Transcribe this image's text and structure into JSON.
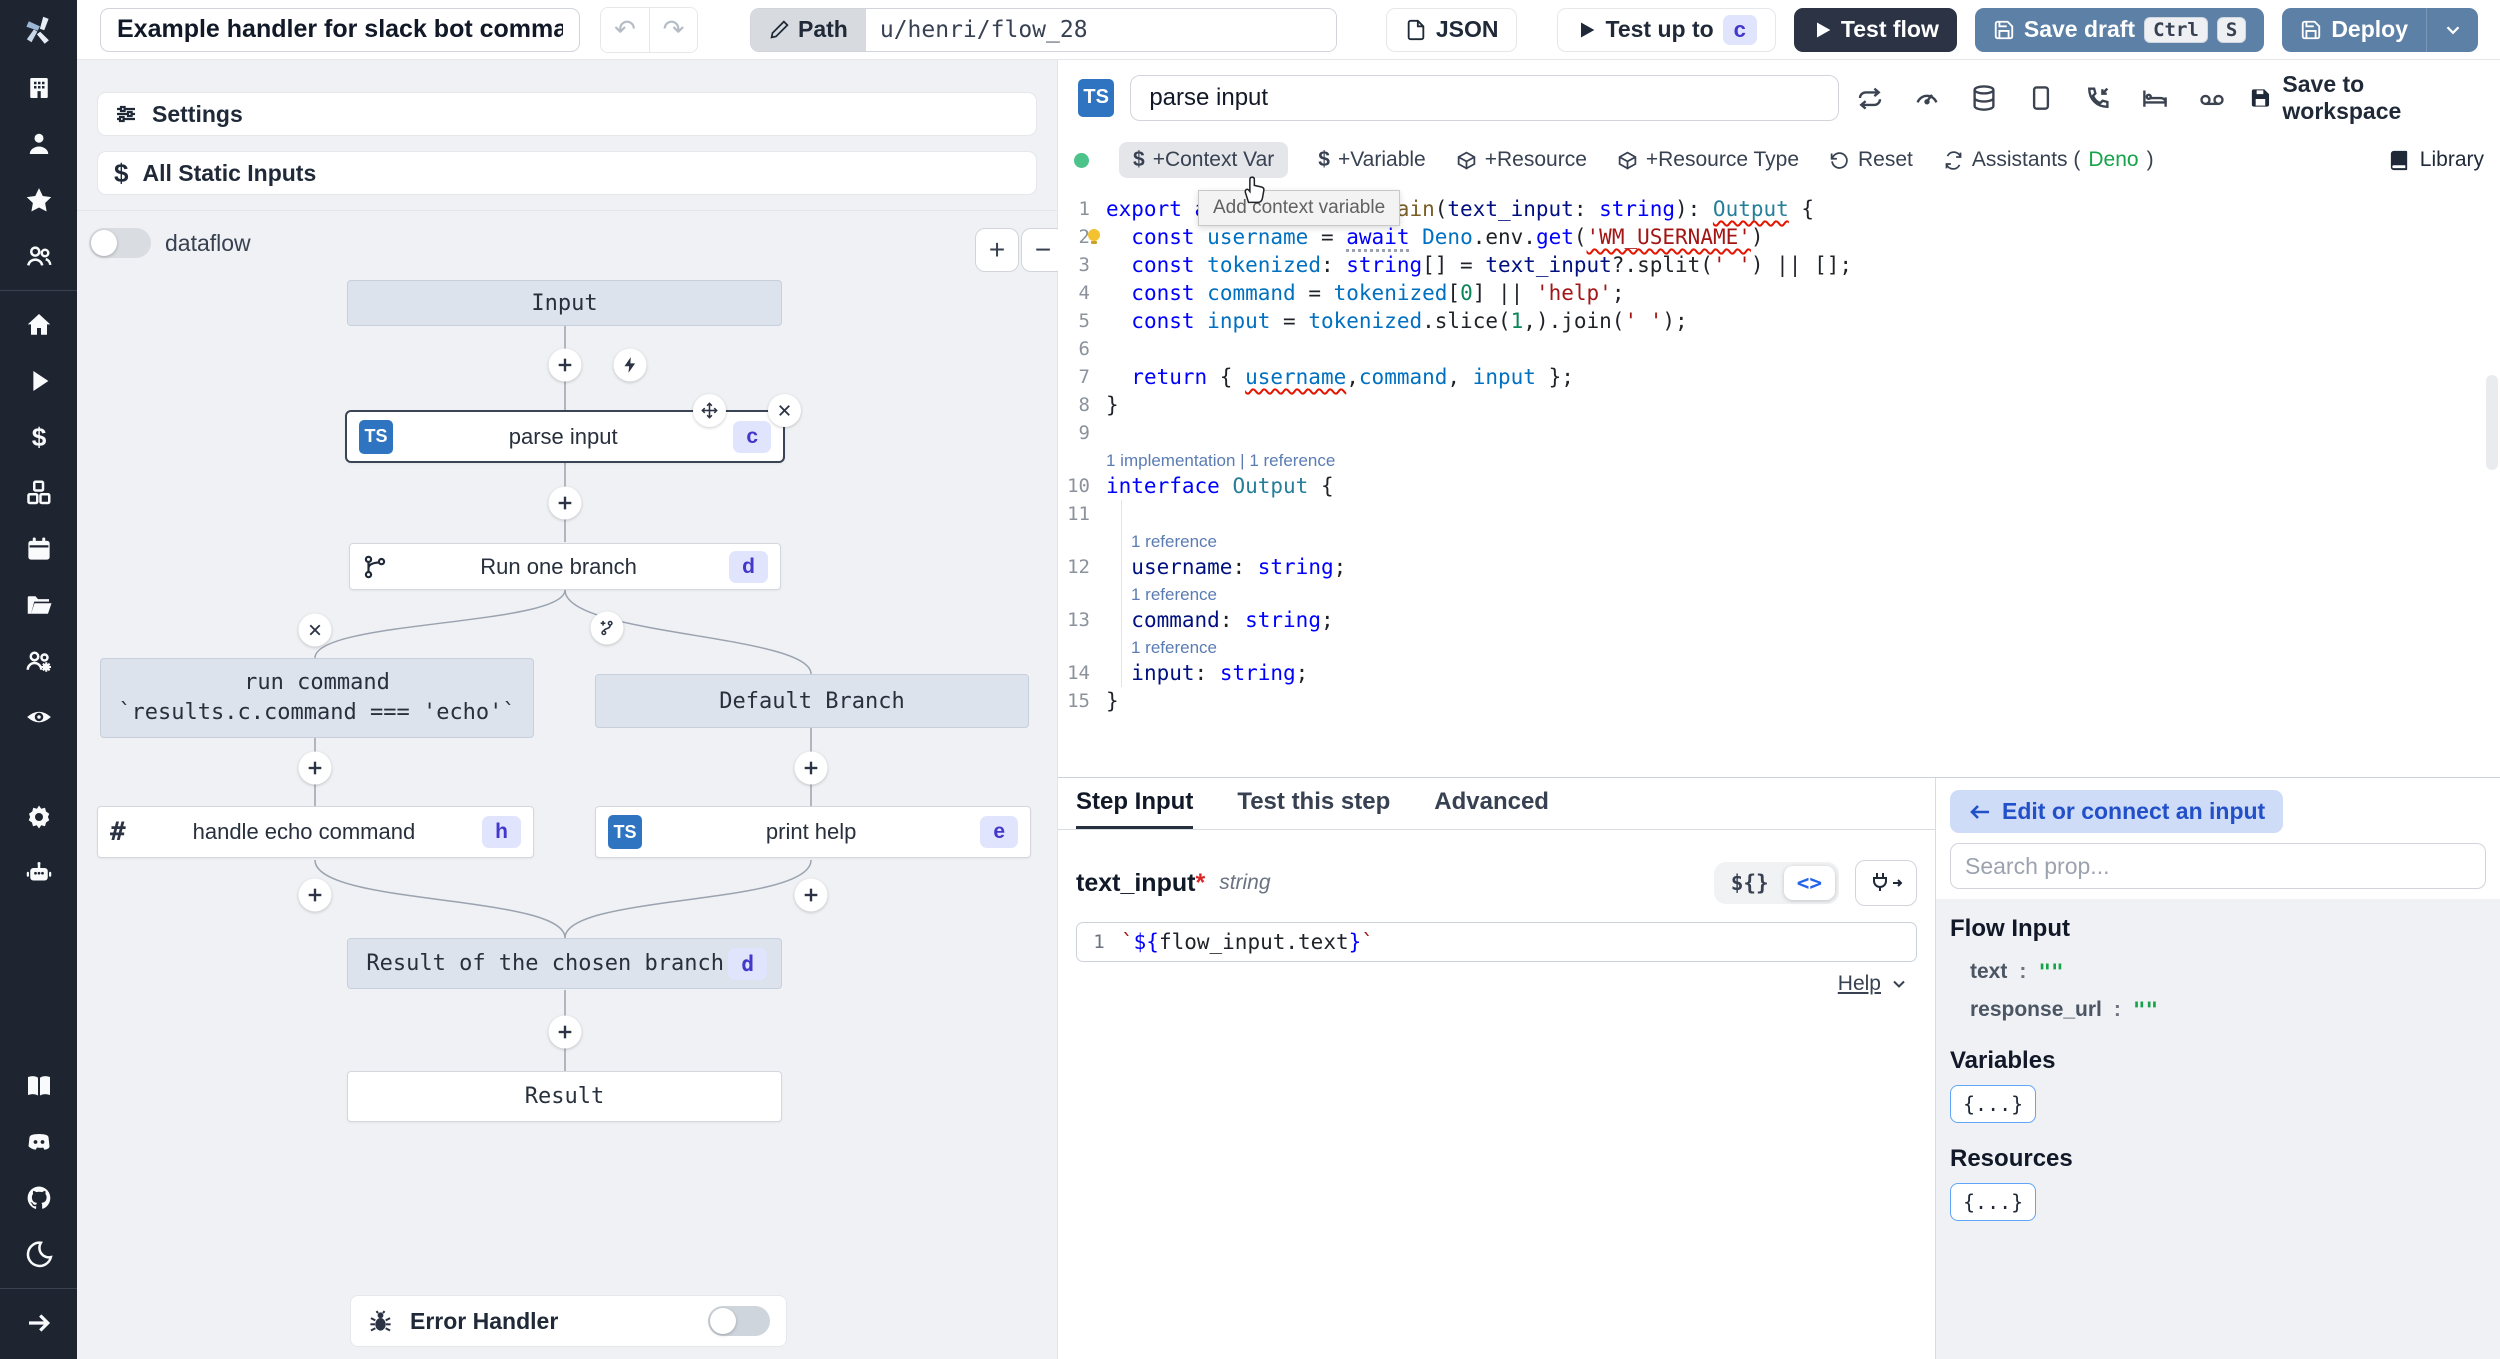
{
  "topbar": {
    "title": "Example handler for slack bot commands",
    "path": {
      "label": "Path",
      "value": "u/henri/flow_28"
    },
    "json_label": "JSON",
    "test_up_to": {
      "label": "Test up to",
      "step": "c"
    },
    "test_flow": "Test flow",
    "save_draft": {
      "label": "Save draft",
      "kbd1": "Ctrl",
      "kbd2": "S"
    },
    "deploy": "Deploy"
  },
  "sidebar": {
    "top_icons": [
      "workspace",
      "user",
      "star",
      "users"
    ],
    "menu_icons": [
      "home",
      "runs",
      "variables",
      "resources",
      "schedules",
      "folders",
      "groups",
      "audit",
      "settings",
      "ai"
    ],
    "help_icons": [
      "book",
      "discord",
      "github",
      "moon"
    ],
    "footer_icons": [
      "collapse"
    ]
  },
  "flow": {
    "settings": "Settings",
    "all_static_inputs": "All Static Inputs",
    "dataflow": "dataflow",
    "zoom_in": "+",
    "zoom_out": "−",
    "error_handler": "Error Handler",
    "nodes": {
      "input": "Input",
      "parse_input": {
        "label": "parse input",
        "badge": "c",
        "lang": "TS"
      },
      "run_one_branch": {
        "label": "Run one branch",
        "badge": "d"
      },
      "branch_condition": {
        "line1": "run command",
        "line2": "`results.c.command === 'echo'`"
      },
      "default_branch": "Default Branch",
      "handle_echo": {
        "label": "handle echo command",
        "badge": "h"
      },
      "print_help": {
        "label": "print help",
        "badge": "e",
        "lang": "TS"
      },
      "result_branch": {
        "label": "Result of the chosen branch",
        "badge": "d"
      },
      "result": "Result"
    }
  },
  "editor": {
    "step_name": "parse input",
    "lang_badge": "TS",
    "tools": [
      "repeat",
      "gauge",
      "database",
      "square",
      "phone",
      "bed",
      "voicemail"
    ],
    "save_to_workspace": "Save to workspace",
    "library": "Library",
    "toolbar": {
      "context_var": "+Context Var",
      "variable": "+Variable",
      "resource": "+Resource",
      "resource_type": "+Resource Type",
      "reset": "Reset",
      "assistants_prefix": "Assistants (",
      "assistants_engine": "Deno",
      "assistants_suffix": ")"
    },
    "tooltip": "Add context variable",
    "code": [
      {
        "n": "1",
        "tokens": [
          [
            "kw",
            "export async function "
          ],
          [
            "fn",
            "main"
          ],
          [
            "pl",
            "("
          ],
          [
            "pr",
            "text_input"
          ],
          [
            "pl",
            ": "
          ],
          [
            "kw",
            "string"
          ],
          [
            "pl",
            "): "
          ],
          [
            "type sq",
            "Output"
          ],
          [
            "pl",
            " {"
          ]
        ]
      },
      {
        "n": "2",
        "bulb": true,
        "tokens": [
          [
            "pl",
            "  "
          ],
          [
            "kw",
            "const"
          ],
          [
            "pl",
            " "
          ],
          [
            "vr",
            "username"
          ],
          [
            "pl",
            " = "
          ],
          [
            "kw aw",
            "await"
          ],
          [
            "pl",
            " "
          ],
          [
            "vr",
            "Deno"
          ],
          [
            "pl",
            ".env."
          ],
          [
            "kw",
            "get"
          ],
          [
            "pl",
            "("
          ],
          [
            "str sq",
            "'WM_USERNAME'"
          ],
          [
            "pl",
            ")"
          ]
        ]
      },
      {
        "n": "3",
        "tokens": [
          [
            "pl",
            "  "
          ],
          [
            "kw",
            "const"
          ],
          [
            "pl",
            " "
          ],
          [
            "vr",
            "tokenized"
          ],
          [
            "pl",
            ": "
          ],
          [
            "kw",
            "string"
          ],
          [
            "pl",
            "[] = "
          ],
          [
            "pr",
            "text_input"
          ],
          [
            "pl",
            "?.split("
          ],
          [
            "str",
            "' '"
          ],
          [
            "pl",
            ") || [];"
          ]
        ]
      },
      {
        "n": "4",
        "tokens": [
          [
            "pl",
            "  "
          ],
          [
            "kw",
            "const"
          ],
          [
            "pl",
            " "
          ],
          [
            "vr",
            "command"
          ],
          [
            "pl",
            " = "
          ],
          [
            "vr",
            "tokenized"
          ],
          [
            "pl",
            "["
          ],
          [
            "num",
            "0"
          ],
          [
            "pl",
            "] || "
          ],
          [
            "str",
            "'help'"
          ],
          [
            "pl",
            ";"
          ]
        ]
      },
      {
        "n": "5",
        "tokens": [
          [
            "pl",
            "  "
          ],
          [
            "kw",
            "const"
          ],
          [
            "pl",
            " "
          ],
          [
            "vr",
            "input"
          ],
          [
            "pl",
            " = "
          ],
          [
            "vr",
            "tokenized"
          ],
          [
            "pl",
            ".slice("
          ],
          [
            "num",
            "1"
          ],
          [
            "pl",
            ",).join("
          ],
          [
            "str",
            "' '"
          ],
          [
            "pl",
            ");"
          ]
        ]
      },
      {
        "n": "6",
        "tokens": []
      },
      {
        "n": "7",
        "tokens": [
          [
            "pl",
            "  "
          ],
          [
            "kw",
            "return"
          ],
          [
            "pl",
            " { "
          ],
          [
            "vr sq",
            "username"
          ],
          [
            "pl",
            ","
          ],
          [
            "vr",
            "command"
          ],
          [
            "pl",
            ", "
          ],
          [
            "vr",
            "input"
          ],
          [
            "pl",
            " };"
          ]
        ]
      },
      {
        "n": "8",
        "tokens": [
          [
            "pl",
            "}"
          ]
        ]
      },
      {
        "n": "9",
        "tokens": []
      },
      {
        "lens": "1 implementation | 1 reference"
      },
      {
        "n": "10",
        "tokens": [
          [
            "kw",
            "interface"
          ],
          [
            "pl",
            " "
          ],
          [
            "type",
            "Output"
          ],
          [
            "pl",
            " {"
          ]
        ]
      },
      {
        "n": "11",
        "tokens": [],
        "guide": true
      },
      {
        "lens": "1 reference",
        "indent": true,
        "guide": true
      },
      {
        "n": "12",
        "tokens": [
          [
            "pl",
            "  "
          ],
          [
            "pr",
            "username"
          ],
          [
            "pl",
            ": "
          ],
          [
            "kw",
            "string"
          ],
          [
            "pl",
            ";"
          ]
        ],
        "guide": true
      },
      {
        "lens": "1 reference",
        "indent": true,
        "guide": true
      },
      {
        "n": "13",
        "tokens": [
          [
            "pl",
            "  "
          ],
          [
            "pr",
            "command"
          ],
          [
            "pl",
            ": "
          ],
          [
            "kw",
            "string"
          ],
          [
            "pl",
            ";"
          ]
        ],
        "guide": true
      },
      {
        "lens": "1 reference",
        "indent": true,
        "guide": true
      },
      {
        "n": "14",
        "tokens": [
          [
            "pl",
            "  "
          ],
          [
            "pr",
            "input"
          ],
          [
            "pl",
            ": "
          ],
          [
            "kw",
            "string"
          ],
          [
            "pl",
            ";"
          ]
        ],
        "guide": true
      },
      {
        "n": "15",
        "tokens": [
          [
            "pl",
            "}"
          ]
        ]
      }
    ]
  },
  "step_panel": {
    "tabs": [
      "Step Input",
      "Test this step",
      "Advanced"
    ],
    "active_tab": "Step Input",
    "field": {
      "name": "text_input",
      "required": "*",
      "type": "string"
    },
    "toggle": {
      "template": "${}",
      "code": "<>"
    },
    "expr_line_no": "1",
    "expr": [
      [
        "str",
        "`"
      ],
      [
        "kw",
        "${"
      ],
      [
        "pl",
        "flow_input.text"
      ],
      [
        "kw",
        "}"
      ],
      [
        "str",
        "`"
      ]
    ],
    "help": "Help"
  },
  "connect_panel": {
    "edit_button": "Edit or connect an input",
    "search_placeholder": "Search prop...",
    "flow_input_title": "Flow Input",
    "props": [
      {
        "key": "text",
        "value": "\"\""
      },
      {
        "key": "response_url",
        "value": "\"\""
      }
    ],
    "variables_title": "Variables",
    "variables_chip": "{...}",
    "resources_title": "Resources",
    "resources_chip": "{...}"
  },
  "colors": {
    "accent_steel": "#5d80a6",
    "dark_button": "#2b3344",
    "badge_bg": "#e0e4fd",
    "badge_text": "#4338ca",
    "ts_badge": "#2f74c0",
    "deno_green": "#16a34a",
    "ready_dot": "#4cc38a",
    "connect_pill_bg": "#cfdcf8",
    "connect_pill_text": "#2150c8"
  }
}
